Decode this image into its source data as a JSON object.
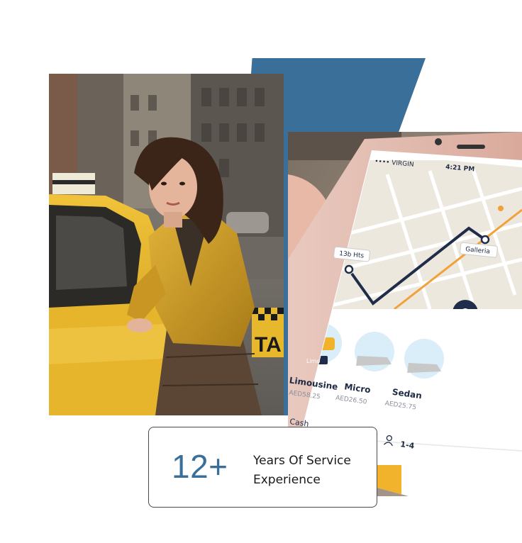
{
  "hero": {
    "left_image": "woman leaning on yellow taxi",
    "right_image": "hand holding phone with ride app"
  },
  "phone": {
    "status_carrier": "•••• VIRGIN",
    "status_time": "4:21 PM",
    "map_labels": {
      "start": "13b Hts",
      "end": "Galleria"
    },
    "vehicles": [
      {
        "name": "Limousine",
        "price": "AED58.25",
        "tag": "Limo"
      },
      {
        "name": "Micro",
        "price": "AED26.50"
      },
      {
        "name": "Sedan",
        "price": "AED25.75"
      }
    ],
    "payment_label": "Cash",
    "seats": "1-4"
  },
  "stats": {
    "number": "12+",
    "label_line1": "Years Of Service",
    "label_line2": "Experience"
  },
  "colors": {
    "accent_blue": "#3a6f99",
    "taxi_yellow": "#e8b82c",
    "jacket_yellow": "#d3a327"
  }
}
